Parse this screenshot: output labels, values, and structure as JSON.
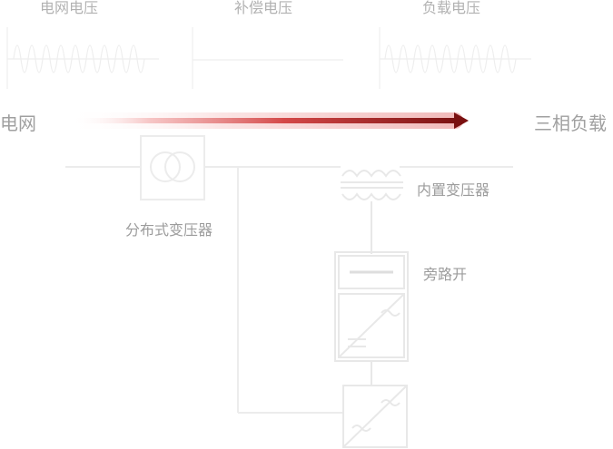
{
  "waveforms": {
    "grid_voltage_label": "电网电压",
    "compensation_voltage_label": "补偿电压",
    "load_voltage_label": "负载电压"
  },
  "flow": {
    "source_label": "电网",
    "target_label": "三相负载"
  },
  "components": {
    "distributed_transformer_label": "分布式变压器",
    "builtin_transformer_label": "内置变压器",
    "bypass_switch_label": "旁路开"
  },
  "colors": {
    "arrow_dark": "#7a1010",
    "arrow_light": "#e86a6a",
    "line_gray": "#eeeeee",
    "text_gray": "#a8a8a8"
  }
}
